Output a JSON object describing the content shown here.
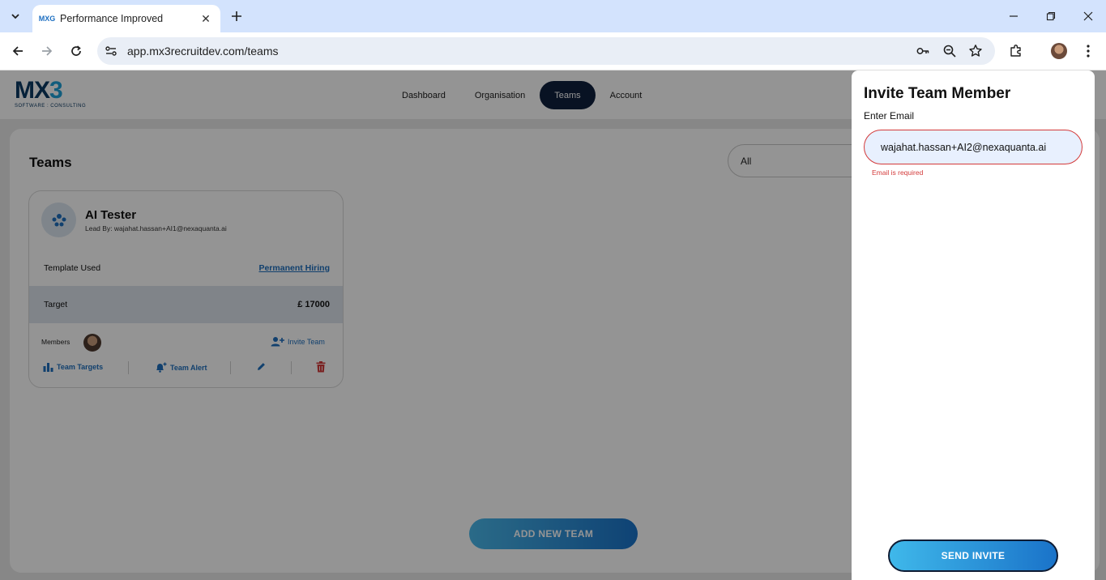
{
  "browser": {
    "tab_title": "Performance Improved",
    "favicon_text": "MXG",
    "url": "app.mx3recruitdev.com/teams"
  },
  "app": {
    "logo_main": "MX",
    "logo_accent": "3",
    "logo_sub": "SOFTWARE : CONSULTING",
    "nav": [
      {
        "label": "Dashboard"
      },
      {
        "label": "Organisation"
      },
      {
        "label": "Teams",
        "active": true
      },
      {
        "label": "Account"
      }
    ],
    "page_title": "Teams",
    "filter": {
      "selected": "All"
    },
    "team_card": {
      "name": "AI Tester",
      "lead": "Lead By: wajahat.hassan+AI1@nexaquanta.ai",
      "template_label": "Template Used",
      "template_value": "Permanent Hiring",
      "target_label": "Target",
      "target_value": "£ 17000",
      "members_label": "Members",
      "invite_label": "Invite Team",
      "actions": {
        "team_targets": "Team Targets",
        "team_alert": "Team Alert"
      }
    },
    "add_team_label": "ADD NEW TEAM"
  },
  "drawer": {
    "title": "Invite Team Member",
    "email_label": "Enter Email",
    "email_value": "wajahat.hassan+AI2@nexaquanta.ai",
    "email_error": "Email is required",
    "send_label": "SEND INVITE"
  },
  "colors": {
    "accent": "#1e6fbd",
    "nav_active": "#0f1f3d",
    "error": "#d33a3a",
    "delete": "#d33a3a"
  }
}
